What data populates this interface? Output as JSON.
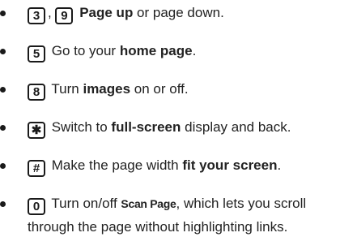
{
  "items": [
    {
      "keys": [
        "3",
        "9"
      ],
      "separator": ",",
      "bold": "Page up",
      "rest": " or page down."
    },
    {
      "keys": [
        "5"
      ],
      "pre": " Go to your ",
      "bold": "home page",
      "post": "."
    },
    {
      "keys": [
        "8"
      ],
      "pre": " Turn ",
      "bold": "images",
      "post": " on or off."
    },
    {
      "keys": [
        "✱"
      ],
      "pre": " Switch to ",
      "bold": "full-screen",
      "post": " display and back."
    },
    {
      "keys": [
        "#"
      ],
      "pre": " Make the page width ",
      "bold": "fit your screen",
      "post": "."
    },
    {
      "keys": [
        "0"
      ],
      "pre": " Turn on/off ",
      "bold": "Scan Page",
      "post": ", which lets you scroll",
      "line2": "through the page without highlighting links."
    }
  ]
}
